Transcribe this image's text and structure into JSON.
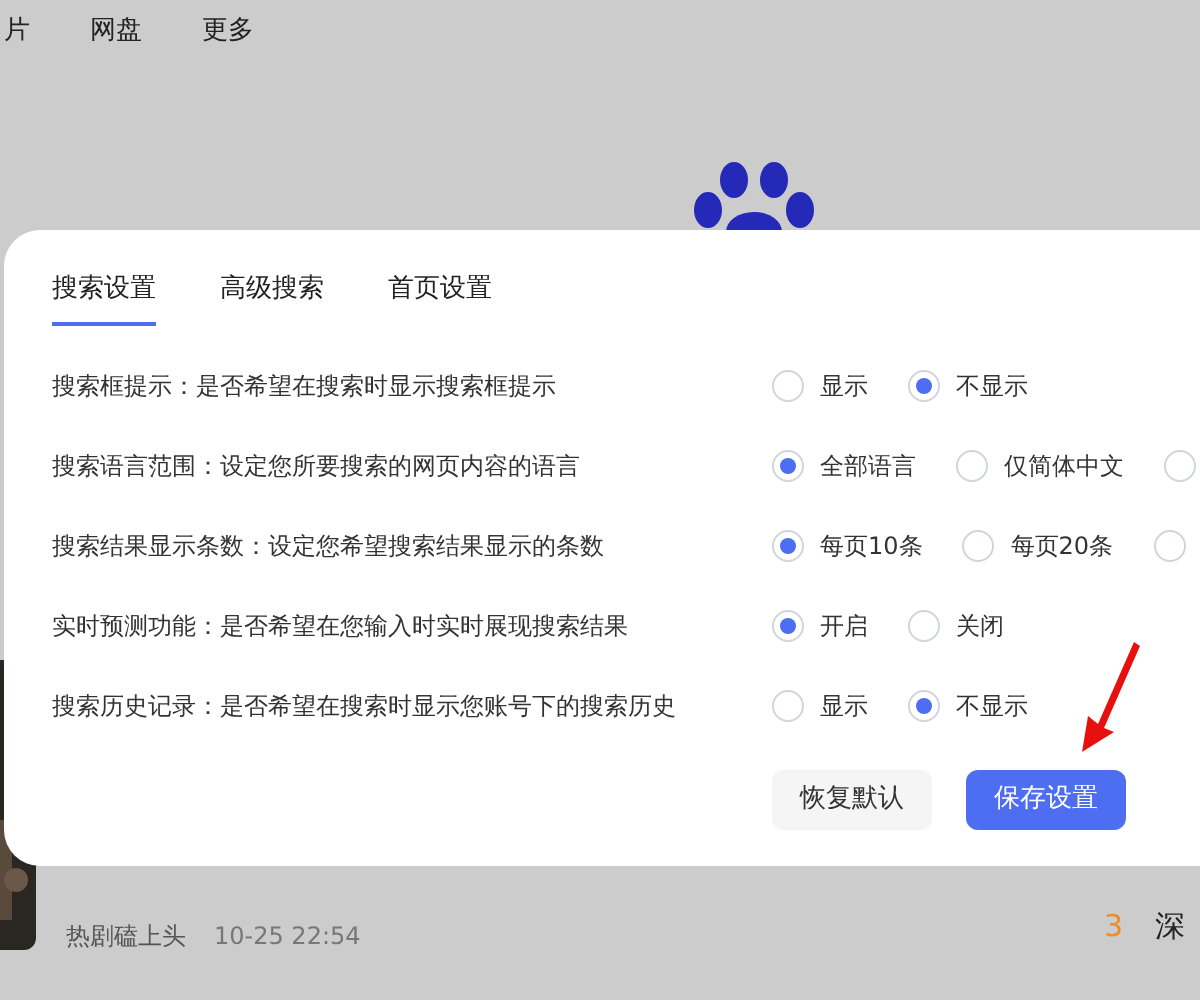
{
  "top_nav": [
    "片",
    "网盘",
    "更多"
  ],
  "news": {
    "source": "热剧磕上头",
    "time": "10-25 22:54"
  },
  "hot_ranks": [
    {
      "rank": "3",
      "color": "#f08b28",
      "title": "深"
    }
  ],
  "dialog": {
    "tabs": [
      {
        "label": "搜索设置",
        "selected": true
      },
      {
        "label": "高级搜索",
        "selected": false
      },
      {
        "label": "首页设置",
        "selected": false
      }
    ],
    "settings": [
      {
        "title": "搜索框提示：",
        "description": "是否希望在搜索时显示搜索框提示",
        "options": [
          {
            "label": "显示",
            "selected": false
          },
          {
            "label": "不显示",
            "selected": true
          }
        ]
      },
      {
        "title": "搜索语言范围：",
        "description": "设定您所要搜索的网页内容的语言",
        "options": [
          {
            "label": "全部语言",
            "selected": true
          },
          {
            "label": "仅简体中文",
            "selected": false
          },
          {
            "selected": false
          }
        ]
      },
      {
        "title": "搜索结果显示条数：",
        "description": "设定您希望搜索结果显示的条数",
        "options": [
          {
            "label": "每页10条",
            "selected": true
          },
          {
            "label": "每页20条",
            "selected": false
          },
          {
            "selected": false
          }
        ]
      },
      {
        "title": "实时预测功能：",
        "description": "是否希望在您输入时实时展现搜索结果",
        "options": [
          {
            "label": "开启",
            "selected": true
          },
          {
            "label": "关闭",
            "selected": false
          }
        ]
      },
      {
        "title": "搜索历史记录：",
        "description": "是否希望在搜索时显示您账号下的搜索历史",
        "options": [
          {
            "label": "显示",
            "selected": false
          },
          {
            "label": "不显示",
            "selected": true
          }
        ]
      }
    ],
    "buttons": [
      {
        "label": "恢复默认",
        "kind": "secondary"
      },
      {
        "label": "保存设置",
        "kind": "primary"
      }
    ]
  }
}
